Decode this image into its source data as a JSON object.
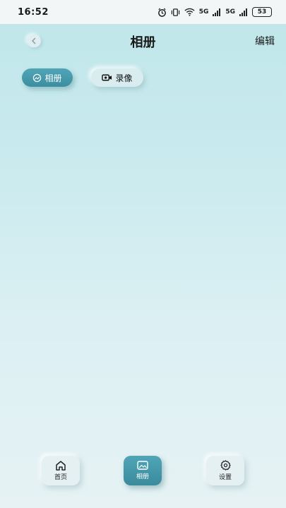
{
  "status_bar": {
    "time": "16:52",
    "signal1": "5G",
    "signal2": "5G",
    "battery": "53"
  },
  "header": {
    "title": "相册",
    "edit_label": "编辑",
    "back_icon": "chevron-left-icon"
  },
  "tabs": [
    {
      "label": "相册",
      "icon": "album-icon",
      "active": true
    },
    {
      "label": "录像",
      "icon": "video-camera-icon",
      "active": false
    }
  ],
  "bottom_nav": [
    {
      "label": "首页",
      "icon": "home-icon",
      "active": false
    },
    {
      "label": "相册",
      "icon": "image-icon",
      "active": true
    },
    {
      "label": "设置",
      "icon": "gear-icon",
      "active": false
    }
  ],
  "colors": {
    "accent": "#4fa5b6",
    "background_top": "#bfe6ea",
    "background_bottom": "#e6f2f4"
  }
}
